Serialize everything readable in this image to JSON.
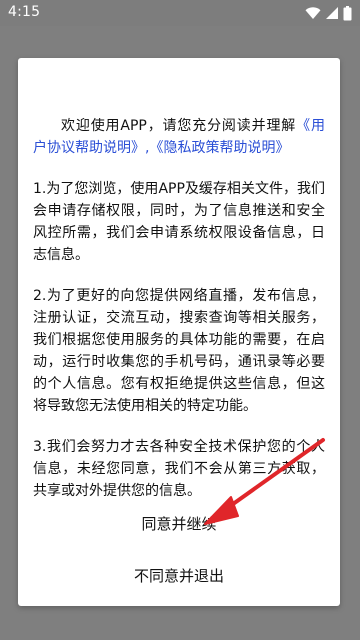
{
  "status_bar": {
    "time": "4:15",
    "icons": [
      "wifi-icon",
      "signal-icon",
      "battery-icon"
    ]
  },
  "dialog": {
    "intro": {
      "prefix": "欢迎使用APP，请您充分阅读并理解",
      "link1": "《用户协议帮助说明》",
      "separator": ",",
      "link2": "《隐私政策帮助说明》"
    },
    "paragraphs": [
      "1.为了您浏览，使用APP及缓存相关文件，我们会申请存储权限，同时，为了信息推送和安全风控所需，我们会申请系统权限设备信息，日志信息。",
      "2.为了更好的向您提供网络直播，发布信息，注册认证，交流互动，搜索查询等相关服务，我们根据您使用服务的具体功能的需要，在启动，运行时收集您的手机号码，通讯录等必要的个人信息。您有权拒绝提供这些信息，但这将导致您无法使用相关的特定功能。",
      "3.我们会努力才去各种安全技术保护您的个人信息，未经您同意，我们不会从第三方获取，共享或对外提供您的信息。"
    ],
    "agree_button": "同意并继续",
    "disagree_button": "不同意并退出"
  },
  "colors": {
    "link": "#2b4fd6",
    "overlay": "#7f7f7f",
    "annotation_arrow": "#e0262a"
  }
}
